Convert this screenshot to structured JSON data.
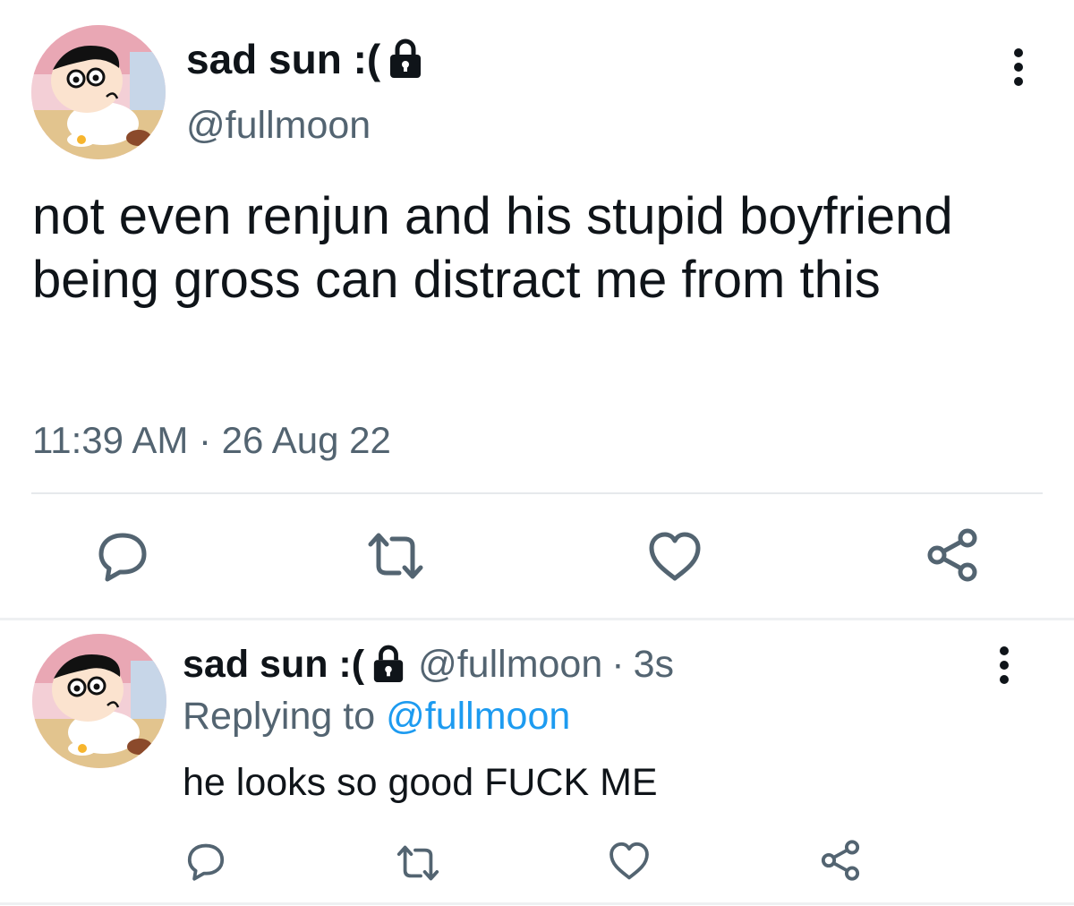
{
  "colors": {
    "text_primary": "#0f1419",
    "text_secondary": "#536471",
    "link": "#1d9bf0",
    "divider": "#e6e9ec"
  },
  "main_tweet": {
    "display_name": "sad sun :(",
    "protected_icon": "lock-icon",
    "handle": "@fullmoon",
    "text": "not even renjun and his stupid boyfriend being gross can distract me from this",
    "timestamp": "11:39 AM · 26 Aug 22",
    "more_icon": "more-vertical-icon",
    "actions": [
      "reply-icon",
      "retweet-icon",
      "like-icon",
      "share-icon"
    ]
  },
  "reply_tweet": {
    "display_name": "sad sun :(",
    "protected_icon": "lock-icon",
    "handle": "@fullmoon",
    "separator": "·",
    "time": "3s",
    "replying_prefix": "Replying to",
    "replying_handle": "@fullmoon",
    "text": "he looks so good FUCK ME",
    "more_icon": "more-vertical-icon",
    "actions": [
      "reply-icon",
      "retweet-icon",
      "like-icon",
      "share-icon"
    ]
  }
}
